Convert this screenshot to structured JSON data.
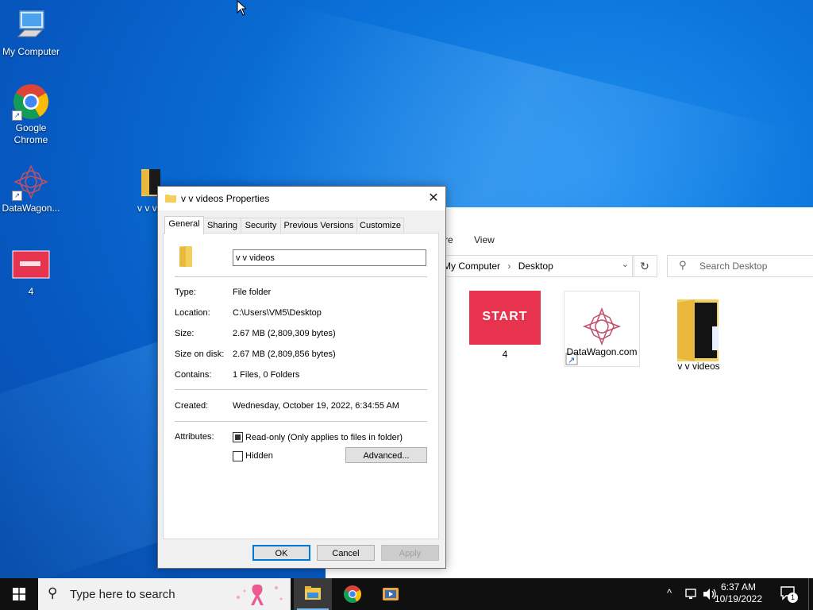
{
  "desktop": {
    "icons": [
      {
        "label": "My Computer"
      },
      {
        "label": "Google Chrome"
      },
      {
        "label": "DataWagon..."
      },
      {
        "label": "v v vid"
      },
      {
        "label": "4"
      }
    ]
  },
  "explorer": {
    "ribbon_tabs": [
      "re",
      "View"
    ],
    "breadcrumb": [
      "My Computer",
      "Desktop"
    ],
    "search_placeholder": "Search Desktop",
    "items": [
      {
        "label": "4",
        "thumb_text": "START"
      },
      {
        "label": "DataWagon.com"
      },
      {
        "label": "v v videos"
      }
    ]
  },
  "dialog": {
    "title": "v v videos Properties",
    "close": "✕",
    "tabs": [
      "General",
      "Sharing",
      "Security",
      "Previous Versions",
      "Customize"
    ],
    "active_tab": "General",
    "name_value": "v v videos",
    "fields": {
      "type_label": "Type:",
      "type_value": "File folder",
      "location_label": "Location:",
      "location_value": "C:\\Users\\VM5\\Desktop",
      "size_label": "Size:",
      "size_value": "2.67 MB (2,809,309 bytes)",
      "size_on_disk_label": "Size on disk:",
      "size_on_disk_value": "2.67 MB (2,809,856 bytes)",
      "contains_label": "Contains:",
      "contains_value": "1 Files, 0 Folders",
      "created_label": "Created:",
      "created_value": "Wednesday, October 19, 2022, 6:34:55 AM",
      "attributes_label": "Attributes:"
    },
    "readonly_label": "Read-only (Only applies to files in folder)",
    "readonly_state": "indeterminate",
    "hidden_label": "Hidden",
    "hidden_checked": false,
    "advanced_button": "Advanced...",
    "ok_button": "OK",
    "cancel_button": "Cancel",
    "apply_button": "Apply"
  },
  "taskbar": {
    "search_placeholder": "Type here to search",
    "time": "6:37 AM",
    "date": "10/19/2022",
    "notification_count": "1"
  },
  "colors": {
    "accent": "#0078d7",
    "desktop_blue": "#0a72d9",
    "taskbar": "#101010"
  }
}
